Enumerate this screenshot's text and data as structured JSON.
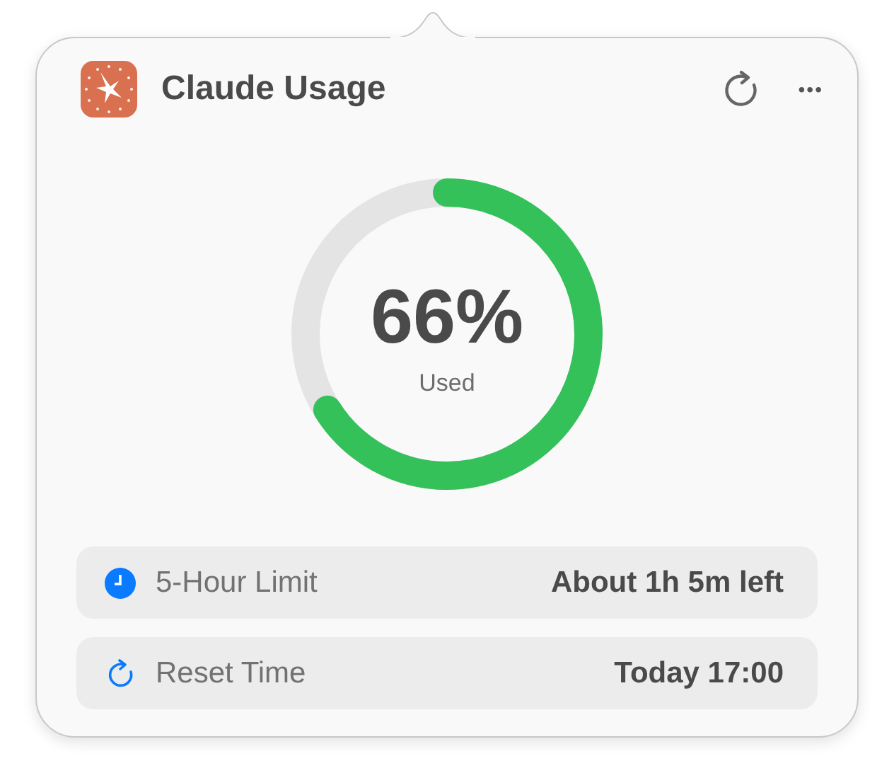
{
  "header": {
    "title": "Claude Usage",
    "more": "•••"
  },
  "gauge": {
    "level": 0.66,
    "percent": "66%",
    "caption": "Used"
  },
  "rows": [
    {
      "kind": "clock",
      "label": "5-Hour Limit",
      "value": "About 1h 5m left"
    },
    {
      "kind": "reset",
      "label": "Reset Time",
      "value": "Today 17:00"
    }
  ]
}
